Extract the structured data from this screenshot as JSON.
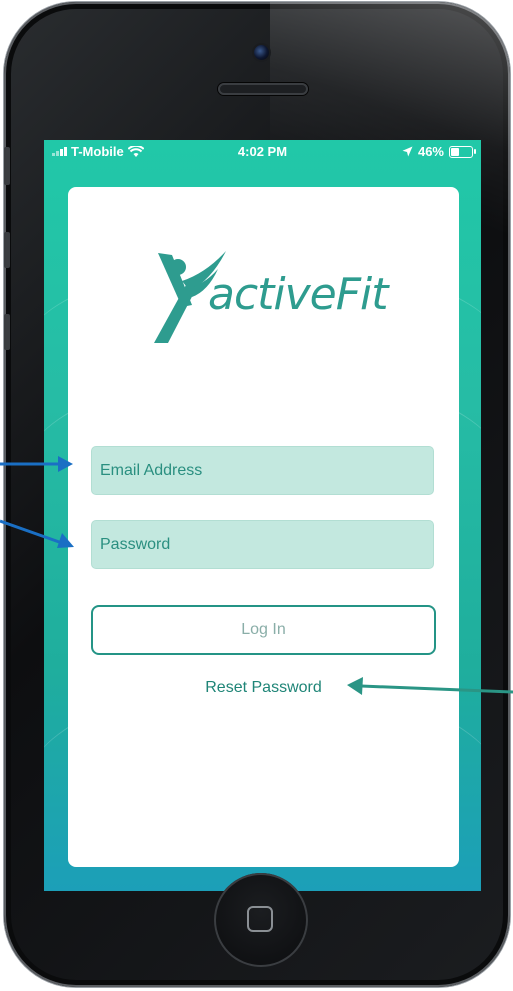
{
  "status_bar": {
    "carrier": "T-Mobile",
    "time": "4:02 PM",
    "battery_percent": "46%",
    "battery_level": 0.46,
    "icons": [
      "signal-bars-icon",
      "wifi-icon",
      "location-arrow-icon",
      "battery-icon"
    ]
  },
  "logo": {
    "text": "activeFit",
    "icon": "running-person-x-icon"
  },
  "form": {
    "email_placeholder": "Email Address",
    "email_value": "",
    "password_placeholder": "Password",
    "password_value": "",
    "login_label": "Log In",
    "reset_label": "Reset Password"
  },
  "annotations": {
    "arrows": [
      "email-pointer-arrow",
      "password-pointer-arrow",
      "reset-pointer-arrow"
    ],
    "left_arrow_color": "#1a6fc4",
    "right_arrow_color": "#2a9585"
  },
  "colors": {
    "accent": "#249486",
    "field_bg": "#c3e8df",
    "screen_bg": "#21c8a8"
  }
}
